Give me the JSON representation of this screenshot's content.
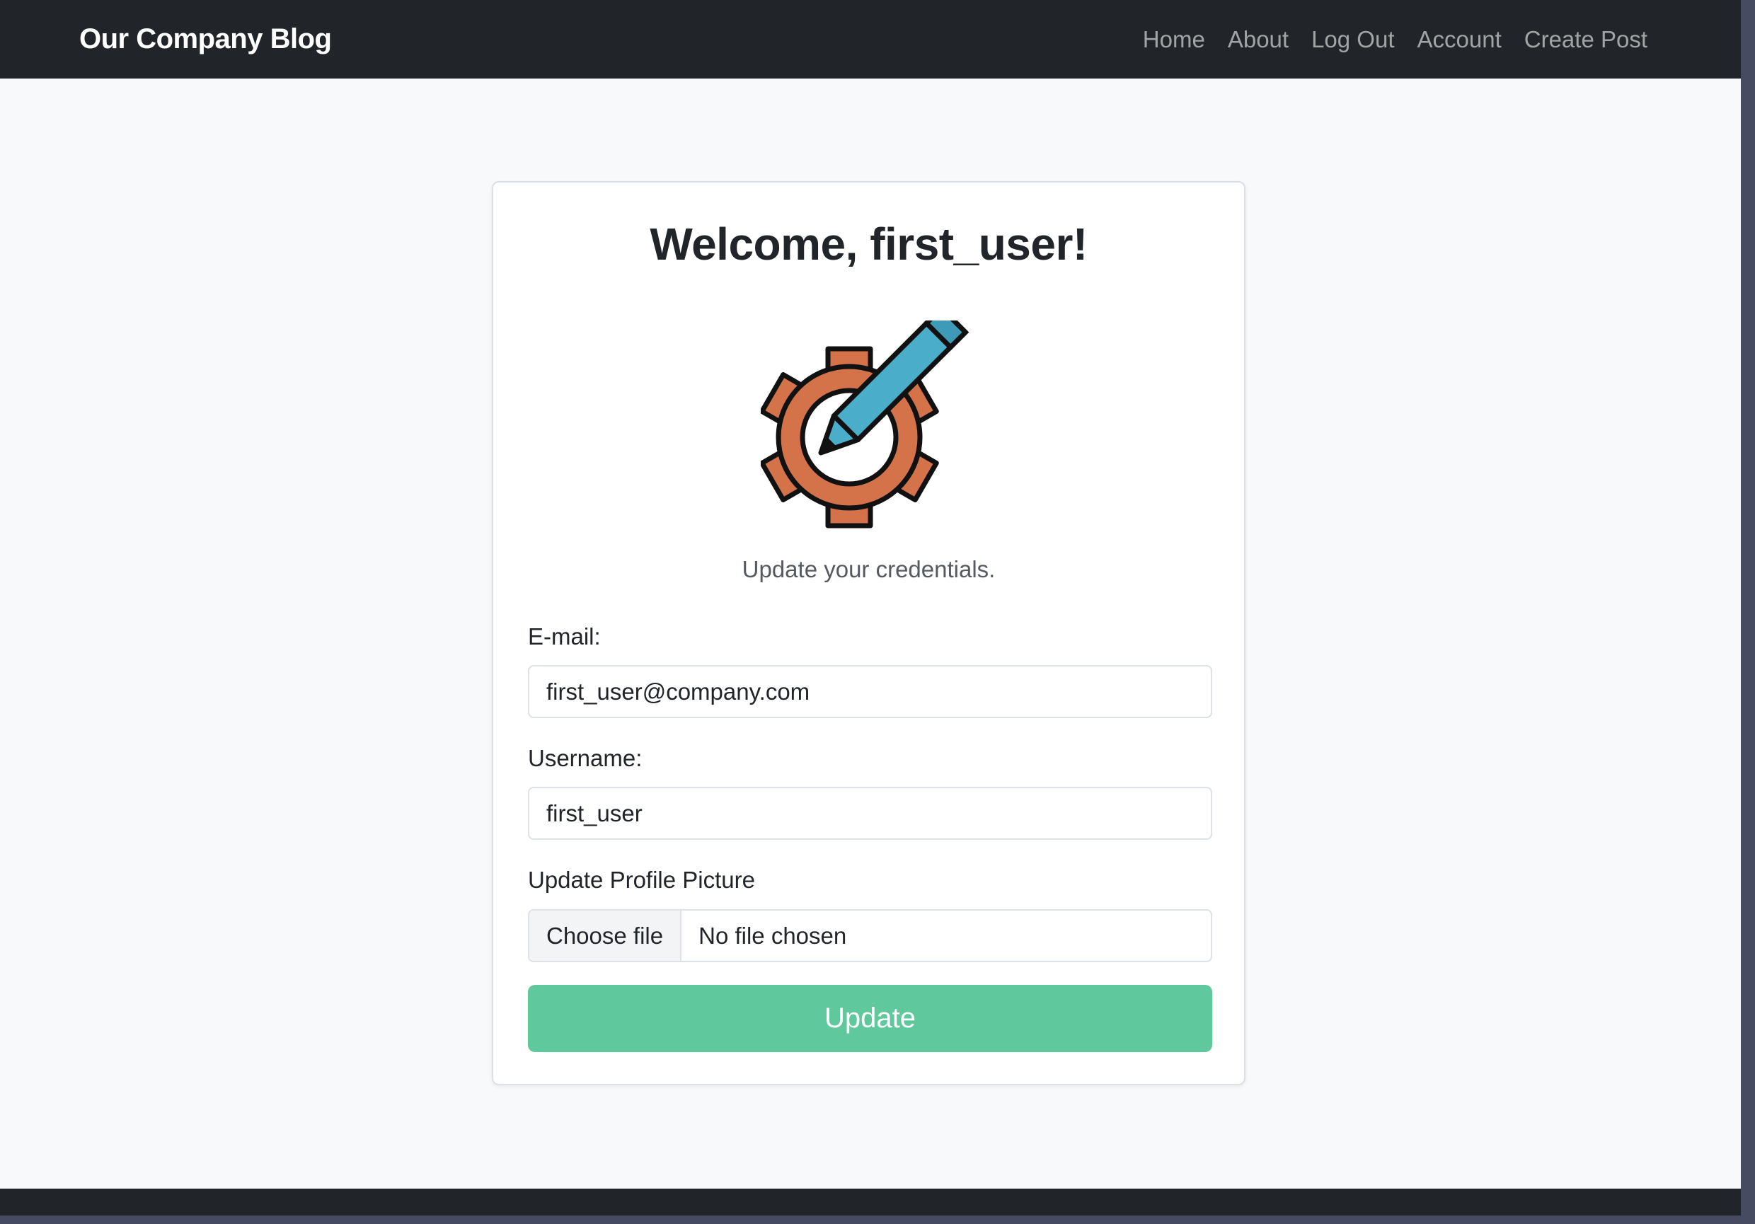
{
  "navbar": {
    "brand": "Our Company Blog",
    "links": [
      "Home",
      "About",
      "Log Out",
      "Account",
      "Create Post"
    ]
  },
  "card": {
    "title": "Welcome, first_user!",
    "logo_icon": "gear-pencil-icon",
    "subtitle": "Update your credentials."
  },
  "form": {
    "email_label": "E-mail:",
    "email_value": "first_user@company.com",
    "username_label": "Username:",
    "username_value": "first_user",
    "picture_label": "Update Profile Picture",
    "file_button": "Choose file",
    "file_status": "No file chosen",
    "submit_label": "Update"
  },
  "colors": {
    "navbar": "#212529",
    "accent_button": "#60c89d",
    "gear": "#d4734a",
    "pencil": "#4aaecb"
  }
}
